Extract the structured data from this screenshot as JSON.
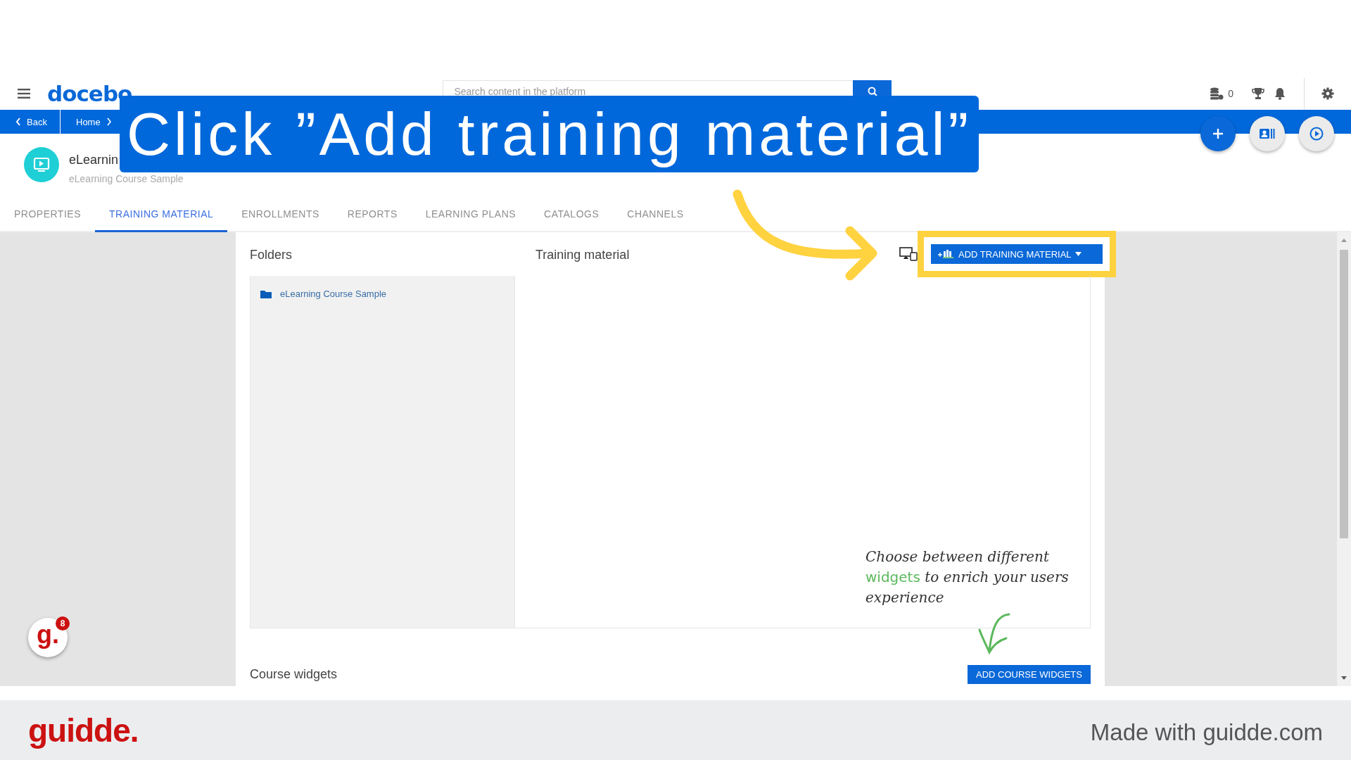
{
  "header": {
    "logo": "docebo",
    "search": {
      "placeholder": "Search content in the platform"
    },
    "coins": "0"
  },
  "breadcrumb": [
    {
      "label": "Back",
      "kind": "back"
    },
    {
      "label": "Home",
      "kind": "crumb"
    }
  ],
  "course": {
    "title": "eLearnin",
    "subtitle": "eLearning Course Sample"
  },
  "tabs": [
    {
      "label": "PROPERTIES",
      "selected": false
    },
    {
      "label": "TRAINING MATERIAL",
      "selected": true
    },
    {
      "label": "ENROLLMENTS",
      "selected": false
    },
    {
      "label": "REPORTS",
      "selected": false
    },
    {
      "label": "LEARNING PLANS",
      "selected": false
    },
    {
      "label": "CATALOGS",
      "selected": false
    },
    {
      "label": "CHANNELS",
      "selected": false
    }
  ],
  "panel": {
    "folders_heading": "Folders",
    "material_heading": "Training material",
    "add_button": "ADD TRAINING MATERIAL",
    "folders": [
      {
        "label": "eLearning Course Sample"
      }
    ],
    "widgets_heading": "Course widgets",
    "widgets_button": "ADD COURSE WIDGETS"
  },
  "annotation": {
    "segments": [
      {
        "text": "Choose between different ",
        "highlight": false
      },
      {
        "text": "widgets",
        "highlight": true
      },
      {
        "text": " to enrich your users experience",
        "highlight": false
      }
    ]
  },
  "guide_badge": {
    "letter": "g.",
    "count": "8"
  },
  "banner": {
    "text": "Click ”Add training material”"
  },
  "footer": {
    "logo": "guidde.",
    "credit": "Made with guidde.com"
  }
}
